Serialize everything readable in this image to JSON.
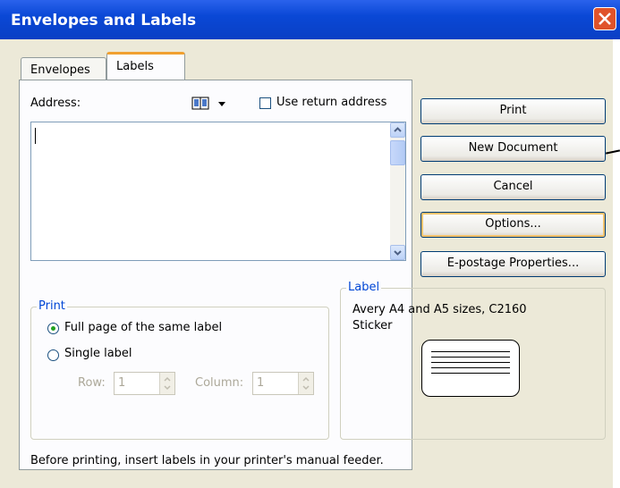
{
  "window": {
    "title": "Envelopes and Labels"
  },
  "tabs": [
    {
      "label": "Envelopes",
      "active": false
    },
    {
      "label": "Labels",
      "active": true
    }
  ],
  "address": {
    "label": "Address:",
    "book_icon": "address-book-icon",
    "value": "",
    "use_return_address_label": "Use return address",
    "use_return_address_checked": false
  },
  "buttons": {
    "print": "Print",
    "new_document": "New Document",
    "cancel": "Cancel",
    "options": "Options...",
    "epostage": "E-postage Properties..."
  },
  "print_group": {
    "title": "Print",
    "full_page_label": "Full page of the same label",
    "single_label": "Single label",
    "selected": "full_page",
    "row_label": "Row:",
    "row_value": "1",
    "column_label": "Column:",
    "column_value": "1"
  },
  "label_group": {
    "title": "Label",
    "line1": "Avery A4 and A5 sizes, C2160",
    "line2": "Sticker"
  },
  "footer_note": "Before printing, insert labels in your printer's manual feeder.",
  "colors": {
    "titlebar": "#0a48d6",
    "close": "#e0532a",
    "group_title": "#0046d5",
    "focus": "#f4c26b"
  }
}
